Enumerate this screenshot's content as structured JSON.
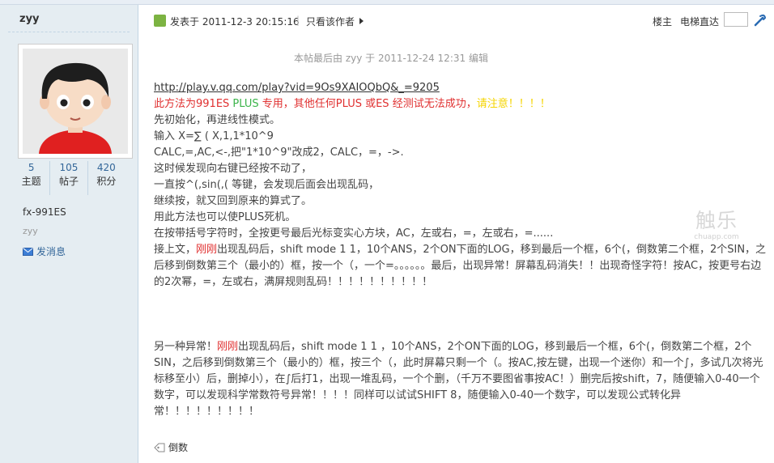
{
  "sidebar": {
    "author": "zyy",
    "stats": [
      {
        "num": "5",
        "label": "主题"
      },
      {
        "num": "105",
        "label": "帖子"
      },
      {
        "num": "420",
        "label": "积分"
      }
    ],
    "user_title": "fx-991ES",
    "user_group": "zyy",
    "send_message": "发消息"
  },
  "post_header": {
    "posted": "发表于 2011-12-3 20:15:16",
    "separator": "|",
    "only_author": "只看该作者",
    "floor": "楼主",
    "elevator": "电梯直达"
  },
  "edit_note": "本帖最后由 zyy 于 2011-12-24 12:31 编辑",
  "content": {
    "link": "http://play.v.qq.com/play?vid=9Os9XAIOQbQ&_=9205",
    "warning": {
      "a": "此方法为991ES ",
      "b": "PLUS",
      "c": " 专用，其他任何PLUS 或ES 经测试无法成功，",
      "d": "请注意！！！！"
    },
    "line1": "先初始化，再进线性模式。",
    "line2": "输入 X=∑ ( X,1,1*10^9",
    "line3": "CALC,=,AC,<-,把\"1*10^9\"改成2，CALC，=，->.",
    "line4": "这时候发现向右键已经按不动了，",
    "line5": "一直按^(,sin(,( 等键，会发现后面会出现乱码，",
    "line6": "继续按，就又回到原来的算式了。",
    "line7": "用此方法也可以使PLUS死机。",
    "line8": "在按带括号字符时，全按更号最后光标变实心方块，AC，左或右，=，左或右，=......",
    "para1": {
      "a": "接上文，",
      "b": "刚刚",
      "c": "出现乱码后，shift mode 1 1，10个ANS，2个ON下面的LOG，移到最后一个框，6个(，倒数第二个框，2个SIN，之后移到倒数第三个（最小的）框，按一个（，一个=。。。。。。最后，出现异常！屏幕乱码消失！！出现奇怪字符！按AC，按更号右边的2次幂，=，左或右，满屏规则乱码！！！！！！！！！！"
    },
    "para2": {
      "a": "另一种异常！",
      "b": "刚刚",
      "c": "出现乱码后，shift mode 1 1 ，10个ANS，2个ON下面的LOG，移到最后一个框，6个(，倒数第二个框，2个SIN，之后移到倒数第三个（最小的）框，按三个（，此时屏幕只剩一个（。按AC,按左键，出现一个迷你）和一个∫，多试几次将光标移至小）后，删掉小），在∫后打1，出现一堆乱码，一个个删，（千万不要图省事按AC！）删完后按shift，7，随便输入0-40一个数字，可以发现科学常数符号异常！！！！同样可以试试SHIFT 8，随便输入0-40一个数字，可以发现公式转化异常！！！！！！！！！"
    }
  },
  "tag": "倒数",
  "watermark": {
    "logo": "触乐",
    "url": "chuapp.com"
  },
  "colors": {
    "red": "#e03030",
    "green": "#3cb44b",
    "yellow": "#f5d400",
    "link": "#336699",
    "sidebar_bg": "#e5edf2"
  }
}
